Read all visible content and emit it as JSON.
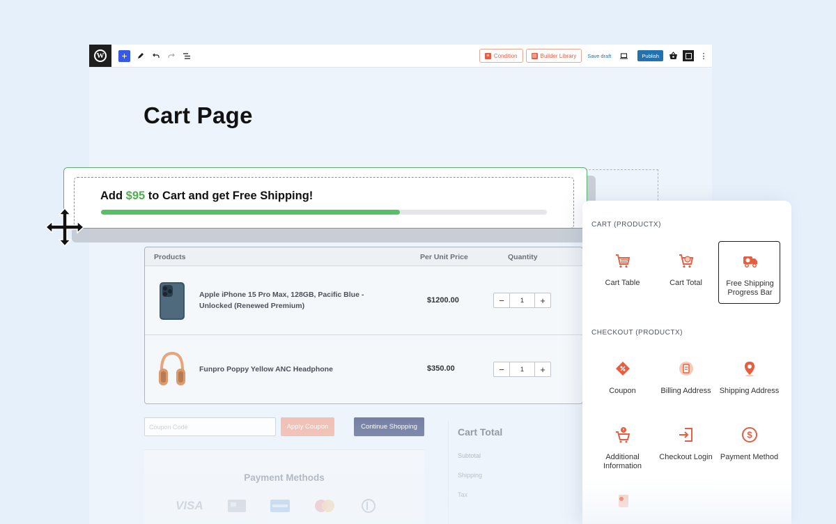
{
  "toolbar": {
    "condition_label": "Condition",
    "builder_library_label": "Builder Library",
    "save_draft_label": "Save draft",
    "publish_label": "Publish"
  },
  "page": {
    "title": "Cart Page"
  },
  "shipping_bar": {
    "text_before": "Add ",
    "amount": "$95",
    "text_after": " to Cart and get Free Shipping!",
    "progress_fraction": 0.67,
    "fill_color": "#55c164",
    "accent_color": "#4caf50"
  },
  "cart_table": {
    "headers": {
      "products": "Products",
      "unit_price": "Per Unit Price",
      "quantity": "Quantity"
    },
    "rows": [
      {
        "name": "Apple iPhone 15 Pro Max, 128GB, Pacific Blue - Unlocked (Renewed Premium)",
        "price": "$1200.00",
        "qty": "1"
      },
      {
        "name": "Funpro Poppy Yellow ANC Headphone",
        "price": "$350.00",
        "qty": "1"
      }
    ],
    "minus": "−",
    "plus": "+"
  },
  "coupon": {
    "placeholder": "Coupon Code",
    "apply_label": "Apply Coupon",
    "continue_label": "Continue Shopping"
  },
  "payment": {
    "title": "Payment Methods",
    "visa": "VISA"
  },
  "cart_total": {
    "title": "Cart Total",
    "subtotal": "Subtotal",
    "shipping": "Shipping",
    "tax": "Tax"
  },
  "panel": {
    "cart_section": "CART (PRODUCTX)",
    "cart_blocks": [
      {
        "label": "Cart Table",
        "icon": "cart-table-icon"
      },
      {
        "label": "Cart Total",
        "icon": "cart-total-icon"
      },
      {
        "label": "Free Shipping Progress Bar",
        "icon": "free-shipping-icon"
      }
    ],
    "checkout_section": "CHECKOUT (PRODUCTX)",
    "checkout_blocks": [
      {
        "label": "Coupon",
        "icon": "coupon-icon"
      },
      {
        "label": "Billing Address",
        "icon": "billing-icon"
      },
      {
        "label": "Shipping Address",
        "icon": "location-icon"
      },
      {
        "label": "Additional Information",
        "icon": "info-cart-icon"
      },
      {
        "label": "Checkout Login",
        "icon": "login-icon"
      },
      {
        "label": "Payment Method",
        "icon": "dollar-icon"
      }
    ],
    "accent_color": "#e85d3f"
  }
}
